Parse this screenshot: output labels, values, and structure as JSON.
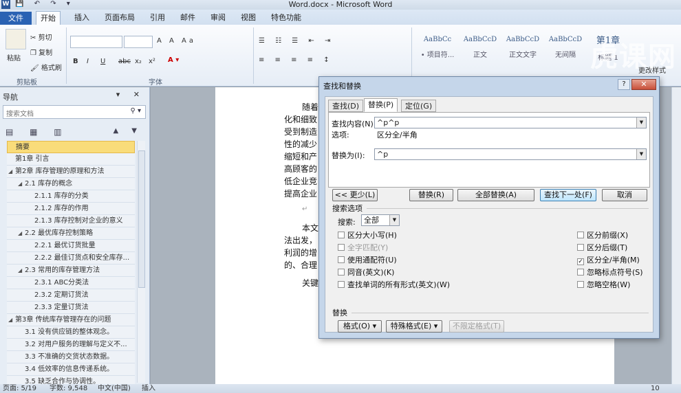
{
  "window": {
    "title": "Word.docx - Microsoft Word",
    "app_icon": "W",
    "qat": "💾 ↶ ↷ ▾"
  },
  "tabs": [
    {
      "label": "文件"
    },
    {
      "label": "开始"
    },
    {
      "label": "插入"
    },
    {
      "label": "页面布局"
    },
    {
      "label": "引用"
    },
    {
      "label": "邮件"
    },
    {
      "label": "审阅"
    },
    {
      "label": "视图"
    },
    {
      "label": "特色功能"
    }
  ],
  "ribbon": {
    "clipboard": {
      "paste": "粘贴",
      "cut": "剪切",
      "copy": "复制",
      "format_painter": "格式刷",
      "group": "剪贴板"
    },
    "font": {
      "group": "字体",
      "bold": "B",
      "italic": "I",
      "underline": "U",
      "strike": "abc",
      "sub": "x₂",
      "sup": "x²"
    },
    "styles": [
      {
        "sample": "AaBbCc",
        "name": "• 项目符..."
      },
      {
        "sample": "AaBbCcD",
        "name": "正文"
      },
      {
        "sample": "AaBbCcD",
        "name": "正文文字"
      },
      {
        "sample": "AaBbCcD",
        "name": "无间隔"
      },
      {
        "sample": "第1章",
        "name": "标题 1"
      }
    ],
    "change_styles": "更改样式",
    "watermark": "虎课网"
  },
  "nav": {
    "title": "导航",
    "search_placeholder": "搜索文档",
    "items": [
      {
        "label": "摘要",
        "level": 1,
        "selected": true,
        "expand": ""
      },
      {
        "label": "第1章 引言",
        "level": 1,
        "expand": ""
      },
      {
        "label": "第2章 库存管理的原理和方法",
        "level": 1,
        "expand": "◢"
      },
      {
        "label": "2.1 库存的概念",
        "level": 2,
        "expand": "◢"
      },
      {
        "label": "2.1.1 库存的分类",
        "level": 3,
        "expand": ""
      },
      {
        "label": "2.1.2 库存的作用",
        "level": 3,
        "expand": ""
      },
      {
        "label": "2.1.3 库存控制对企业的意义",
        "level": 3,
        "expand": ""
      },
      {
        "label": "2.2 最优库存控制策略",
        "level": 2,
        "expand": "◢"
      },
      {
        "label": "2.2.1 最优订货批量",
        "level": 3,
        "expand": ""
      },
      {
        "label": "2.2.2 最佳订货点和安全库存...",
        "level": 3,
        "expand": ""
      },
      {
        "label": "2.3 常用的库存管理方法",
        "level": 2,
        "expand": "◢"
      },
      {
        "label": "2.3.1 ABC分类法",
        "level": 3,
        "expand": ""
      },
      {
        "label": "2.3.2 定期订货法",
        "level": 3,
        "expand": ""
      },
      {
        "label": "2.3.3 定量订货法",
        "level": 3,
        "expand": ""
      },
      {
        "label": "第3章 传统库存管理存在的问题",
        "level": 1,
        "expand": "◢"
      },
      {
        "label": "3.1 没有供应链的整体观念。",
        "level": 2,
        "expand": ""
      },
      {
        "label": "3.2 对用户服务的理解与定义不...",
        "level": 2,
        "expand": ""
      },
      {
        "label": "3.3 不准确的交货状态数据。",
        "level": 2,
        "expand": ""
      },
      {
        "label": "3.4 低效率的信息传递系统。",
        "level": 2,
        "expand": ""
      },
      {
        "label": "3.5 缺乏合作与协调性。",
        "level": 2,
        "expand": ""
      }
    ]
  },
  "document": {
    "lines": [
      "随着",
      "化和细致",
      "受到制造",
      "性的减少",
      "缩短和产",
      "高顾客的",
      "低企业竞",
      "提高企业",
      "↵",
      "本文",
      "法出发，",
      "利润的增",
      "的、合理",
      "关键"
    ]
  },
  "dialog": {
    "title": "查找和替换",
    "help": "?",
    "close": "✕",
    "tabs": [
      "查找(D)",
      "替换(P)",
      "定位(G)"
    ],
    "find_label": "查找内容(N):",
    "find_value": "^p^p",
    "options_label": "选项:",
    "options_value": "区分全/半角",
    "replace_label": "替换为(I):",
    "replace_value": "^p",
    "buttons": {
      "less": "<< 更少(L)",
      "replace": "替换(R)",
      "replace_all": "全部替换(A)",
      "find_next": "查找下一处(F)",
      "cancel": "取消"
    },
    "search_options_title": "搜索选项",
    "search_label": "搜索:",
    "search_value": "全部",
    "left_checks": [
      {
        "label": "区分大小写(H)",
        "checked": false,
        "disabled": false
      },
      {
        "label": "全字匹配(Y)",
        "checked": false,
        "disabled": true
      },
      {
        "label": "使用通配符(U)",
        "checked": false,
        "disabled": false
      },
      {
        "label": "同音(英文)(K)",
        "checked": false,
        "disabled": false
      },
      {
        "label": "查找单词的所有形式(英文)(W)",
        "checked": false,
        "disabled": false
      }
    ],
    "right_checks": [
      {
        "label": "区分前缀(X)",
        "checked": false
      },
      {
        "label": "区分后缀(T)",
        "checked": false
      },
      {
        "label": "区分全/半角(M)",
        "checked": true
      },
      {
        "label": "忽略标点符号(S)",
        "checked": false
      },
      {
        "label": "忽略空格(W)",
        "checked": false
      }
    ],
    "replace_section": "替换",
    "format_btn": "格式(O) ▾",
    "special_btn": "特殊格式(E) ▾",
    "no_format_btn": "不限定格式(T)"
  },
  "status": {
    "page": "页面: 5/19",
    "words": "字数: 9,548",
    "lang": "中文(中国)",
    "mode": "插入",
    "zoom": "10"
  }
}
